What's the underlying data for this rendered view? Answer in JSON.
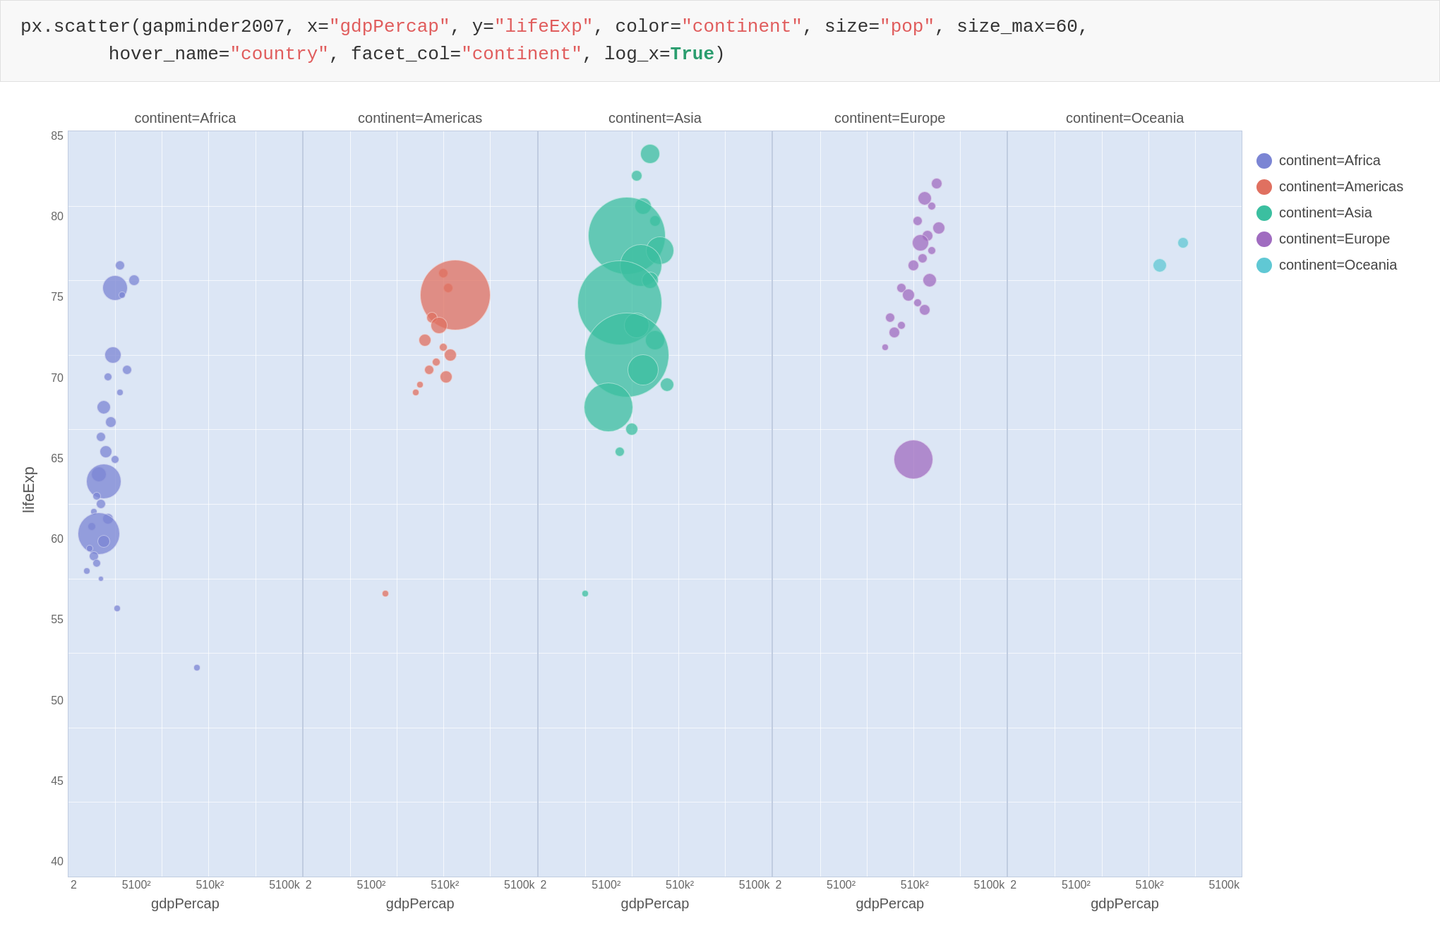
{
  "code": {
    "line1_prefix": "px.scatter(gapminder2007, x=",
    "line1_x": "\"gdpPercap\"",
    "line1_mid1": ", y=",
    "line1_y": "\"lifeExp\"",
    "line1_mid2": ", color=",
    "line1_color": "\"continent\"",
    "line1_mid3": ", size=",
    "line1_size": "\"pop\"",
    "line1_mid4": ", size_max=60,",
    "line2_prefix": "        hover_name=",
    "line2_hover": "\"country\"",
    "line2_mid1": ", facet_col=",
    "line2_facet": "\"continent\"",
    "line2_mid2": ", log_x=",
    "line2_logx": "True",
    "line2_suffix": ")"
  },
  "chart": {
    "y_label": "lifeExp",
    "y_ticks": [
      "85",
      "80",
      "75",
      "70",
      "65",
      "60",
      "55",
      "50",
      "45",
      "40"
    ],
    "x_ticks": [
      "2",
      "5100²",
      "510k²",
      "5100k"
    ]
  },
  "facets": [
    {
      "title": "continent=Africa",
      "x_label": "gdpPercap"
    },
    {
      "title": "continent=Americas",
      "x_label": "gdpPercap"
    },
    {
      "title": "continent=Asia",
      "x_label": "gdpPercap"
    },
    {
      "title": "continent=Europe",
      "x_label": "gdpPercap"
    },
    {
      "title": "continent=Oceania",
      "x_label": "gdpPercap"
    }
  ],
  "legend": {
    "items": [
      {
        "label": "continent=Africa",
        "color": "#7b85d4"
      },
      {
        "label": "continent=Americas",
        "color": "#e07060"
      },
      {
        "label": "continent=Asia",
        "color": "#3bbfa0"
      },
      {
        "label": "continent=Europe",
        "color": "#a06cc0"
      },
      {
        "label": "continent=Oceania",
        "color": "#60c8d4"
      }
    ]
  },
  "africa_bubbles": [
    {
      "x": 0.22,
      "y": 0.82,
      "r": 7,
      "color": "#7b85d4"
    },
    {
      "x": 0.2,
      "y": 0.79,
      "r": 18,
      "color": "#7b85d4"
    },
    {
      "x": 0.28,
      "y": 0.8,
      "r": 8,
      "color": "#7b85d4"
    },
    {
      "x": 0.23,
      "y": 0.78,
      "r": 5,
      "color": "#7b85d4"
    },
    {
      "x": 0.19,
      "y": 0.7,
      "r": 12,
      "color": "#7b85d4"
    },
    {
      "x": 0.25,
      "y": 0.68,
      "r": 7,
      "color": "#7b85d4"
    },
    {
      "x": 0.17,
      "y": 0.67,
      "r": 6,
      "color": "#7b85d4"
    },
    {
      "x": 0.22,
      "y": 0.65,
      "r": 5,
      "color": "#7b85d4"
    },
    {
      "x": 0.15,
      "y": 0.63,
      "r": 10,
      "color": "#7b85d4"
    },
    {
      "x": 0.18,
      "y": 0.61,
      "r": 8,
      "color": "#7b85d4"
    },
    {
      "x": 0.14,
      "y": 0.59,
      "r": 7,
      "color": "#7b85d4"
    },
    {
      "x": 0.16,
      "y": 0.57,
      "r": 9,
      "color": "#7b85d4"
    },
    {
      "x": 0.2,
      "y": 0.56,
      "r": 6,
      "color": "#7b85d4"
    },
    {
      "x": 0.13,
      "y": 0.54,
      "r": 11,
      "color": "#7b85d4"
    },
    {
      "x": 0.15,
      "y": 0.53,
      "r": 25,
      "color": "#7b85d4"
    },
    {
      "x": 0.12,
      "y": 0.51,
      "r": 6,
      "color": "#7b85d4"
    },
    {
      "x": 0.14,
      "y": 0.5,
      "r": 7,
      "color": "#7b85d4"
    },
    {
      "x": 0.11,
      "y": 0.49,
      "r": 5,
      "color": "#7b85d4"
    },
    {
      "x": 0.17,
      "y": 0.48,
      "r": 8,
      "color": "#7b85d4"
    },
    {
      "x": 0.1,
      "y": 0.47,
      "r": 6,
      "color": "#7b85d4"
    },
    {
      "x": 0.13,
      "y": 0.46,
      "r": 30,
      "color": "#7b85d4"
    },
    {
      "x": 0.15,
      "y": 0.45,
      "r": 9,
      "color": "#7b85d4"
    },
    {
      "x": 0.09,
      "y": 0.44,
      "r": 5,
      "color": "#7b85d4"
    },
    {
      "x": 0.11,
      "y": 0.43,
      "r": 7,
      "color": "#7b85d4"
    },
    {
      "x": 0.12,
      "y": 0.42,
      "r": 6,
      "color": "#7b85d4"
    },
    {
      "x": 0.08,
      "y": 0.41,
      "r": 5,
      "color": "#7b85d4"
    },
    {
      "x": 0.14,
      "y": 0.4,
      "r": 4,
      "color": "#7b85d4"
    },
    {
      "x": 0.21,
      "y": 0.36,
      "r": 5,
      "color": "#7b85d4"
    },
    {
      "x": 0.55,
      "y": 0.28,
      "r": 5,
      "color": "#7b85d4"
    }
  ],
  "americas_bubbles": [
    {
      "x": 0.6,
      "y": 0.81,
      "r": 7,
      "color": "#e07060"
    },
    {
      "x": 0.62,
      "y": 0.79,
      "r": 7,
      "color": "#e07060"
    },
    {
      "x": 0.65,
      "y": 0.78,
      "r": 50,
      "color": "#e07060"
    },
    {
      "x": 0.55,
      "y": 0.75,
      "r": 8,
      "color": "#e07060"
    },
    {
      "x": 0.58,
      "y": 0.74,
      "r": 12,
      "color": "#e07060"
    },
    {
      "x": 0.52,
      "y": 0.72,
      "r": 9,
      "color": "#e07060"
    },
    {
      "x": 0.6,
      "y": 0.71,
      "r": 6,
      "color": "#e07060"
    },
    {
      "x": 0.63,
      "y": 0.7,
      "r": 9,
      "color": "#e07060"
    },
    {
      "x": 0.57,
      "y": 0.69,
      "r": 6,
      "color": "#e07060"
    },
    {
      "x": 0.54,
      "y": 0.68,
      "r": 7,
      "color": "#e07060"
    },
    {
      "x": 0.61,
      "y": 0.67,
      "r": 9,
      "color": "#e07060"
    },
    {
      "x": 0.5,
      "y": 0.66,
      "r": 5,
      "color": "#e07060"
    },
    {
      "x": 0.48,
      "y": 0.65,
      "r": 5,
      "color": "#e07060"
    },
    {
      "x": 0.35,
      "y": 0.38,
      "r": 5,
      "color": "#e07060"
    }
  ],
  "asia_bubbles": [
    {
      "x": 0.48,
      "y": 0.97,
      "r": 14,
      "color": "#3bbfa0"
    },
    {
      "x": 0.42,
      "y": 0.94,
      "r": 8,
      "color": "#3bbfa0"
    },
    {
      "x": 0.45,
      "y": 0.9,
      "r": 12,
      "color": "#3bbfa0"
    },
    {
      "x": 0.5,
      "y": 0.88,
      "r": 8,
      "color": "#3bbfa0"
    },
    {
      "x": 0.38,
      "y": 0.86,
      "r": 55,
      "color": "#3bbfa0"
    },
    {
      "x": 0.52,
      "y": 0.84,
      "r": 20,
      "color": "#3bbfa0"
    },
    {
      "x": 0.44,
      "y": 0.82,
      "r": 30,
      "color": "#3bbfa0"
    },
    {
      "x": 0.48,
      "y": 0.8,
      "r": 12,
      "color": "#3bbfa0"
    },
    {
      "x": 0.35,
      "y": 0.77,
      "r": 60,
      "color": "#3bbfa0"
    },
    {
      "x": 0.42,
      "y": 0.74,
      "r": 18,
      "color": "#3bbfa0"
    },
    {
      "x": 0.5,
      "y": 0.72,
      "r": 14,
      "color": "#3bbfa0"
    },
    {
      "x": 0.38,
      "y": 0.7,
      "r": 60,
      "color": "#3bbfa0"
    },
    {
      "x": 0.45,
      "y": 0.68,
      "r": 22,
      "color": "#3bbfa0"
    },
    {
      "x": 0.55,
      "y": 0.66,
      "r": 10,
      "color": "#3bbfa0"
    },
    {
      "x": 0.3,
      "y": 0.63,
      "r": 35,
      "color": "#3bbfa0"
    },
    {
      "x": 0.4,
      "y": 0.6,
      "r": 9,
      "color": "#3bbfa0"
    },
    {
      "x": 0.35,
      "y": 0.57,
      "r": 7,
      "color": "#3bbfa0"
    },
    {
      "x": 0.2,
      "y": 0.38,
      "r": 5,
      "color": "#3bbfa0"
    }
  ],
  "europe_bubbles": [
    {
      "x": 0.7,
      "y": 0.93,
      "r": 8,
      "color": "#a06cc0"
    },
    {
      "x": 0.65,
      "y": 0.91,
      "r": 10,
      "color": "#a06cc0"
    },
    {
      "x": 0.68,
      "y": 0.9,
      "r": 6,
      "color": "#a06cc0"
    },
    {
      "x": 0.62,
      "y": 0.88,
      "r": 7,
      "color": "#a06cc0"
    },
    {
      "x": 0.71,
      "y": 0.87,
      "r": 9,
      "color": "#a06cc0"
    },
    {
      "x": 0.66,
      "y": 0.86,
      "r": 8,
      "color": "#a06cc0"
    },
    {
      "x": 0.63,
      "y": 0.85,
      "r": 12,
      "color": "#a06cc0"
    },
    {
      "x": 0.68,
      "y": 0.84,
      "r": 6,
      "color": "#a06cc0"
    },
    {
      "x": 0.64,
      "y": 0.83,
      "r": 7,
      "color": "#a06cc0"
    },
    {
      "x": 0.6,
      "y": 0.82,
      "r": 8,
      "color": "#a06cc0"
    },
    {
      "x": 0.67,
      "y": 0.8,
      "r": 10,
      "color": "#a06cc0"
    },
    {
      "x": 0.55,
      "y": 0.79,
      "r": 7,
      "color": "#a06cc0"
    },
    {
      "x": 0.58,
      "y": 0.78,
      "r": 9,
      "color": "#a06cc0"
    },
    {
      "x": 0.62,
      "y": 0.77,
      "r": 6,
      "color": "#a06cc0"
    },
    {
      "x": 0.65,
      "y": 0.76,
      "r": 8,
      "color": "#a06cc0"
    },
    {
      "x": 0.5,
      "y": 0.75,
      "r": 7,
      "color": "#a06cc0"
    },
    {
      "x": 0.55,
      "y": 0.74,
      "r": 6,
      "color": "#a06cc0"
    },
    {
      "x": 0.52,
      "y": 0.73,
      "r": 8,
      "color": "#a06cc0"
    },
    {
      "x": 0.48,
      "y": 0.71,
      "r": 5,
      "color": "#a06cc0"
    },
    {
      "x": 0.6,
      "y": 0.56,
      "r": 28,
      "color": "#a06cc0"
    }
  ],
  "oceania_bubbles": [
    {
      "x": 0.75,
      "y": 0.85,
      "r": 8,
      "color": "#60c8d4"
    },
    {
      "x": 0.65,
      "y": 0.82,
      "r": 10,
      "color": "#60c8d4"
    }
  ]
}
